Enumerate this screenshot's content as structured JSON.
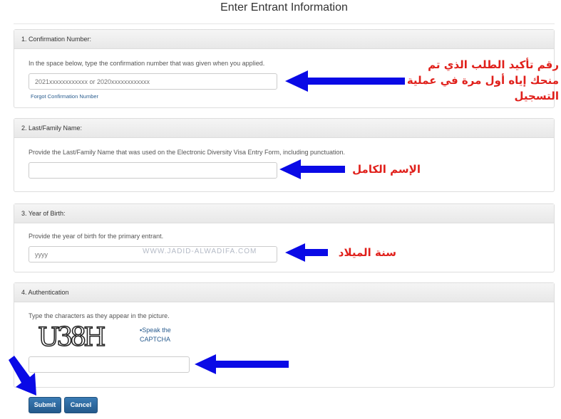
{
  "page_title": "Enter Entrant Information",
  "watermark": "WWW.JADID-ALWADIFA.COM",
  "sections": [
    {
      "header": "1. Confirmation Number:",
      "description": "In the space below, type the confirmation number that was given when you applied.",
      "placeholder": "2021xxxxxxxxxxxx or 2020xxxxxxxxxxxx",
      "link": "Forgot Confirmation Number"
    },
    {
      "header": "2. Last/Family Name:",
      "description": "Provide the Last/Family Name that was used on the Electronic Diversity Visa Entry Form, including punctuation.",
      "placeholder": ""
    },
    {
      "header": "3. Year of Birth:",
      "description": "Provide the year of birth for the primary entrant.",
      "placeholder": "yyyy"
    },
    {
      "header": "4. Authentication",
      "description": "Type the characters as they appear in the picture.",
      "captcha_text": "U38H",
      "speak_alt": "Speak the CAPTCHA",
      "placeholder": ""
    }
  ],
  "buttons": {
    "submit": "Submit",
    "cancel": "Cancel"
  },
  "annotations": {
    "confirmation": "رقم تأكيد الطلب الذي تم منحك إياه أول مرة في عملية التسجيل",
    "name": "الإسم الكامل",
    "birth_year": "سنة الميلاد"
  },
  "colors": {
    "arrow": "#0a0ae6",
    "annotation": "#e0201b",
    "button": "#2d6aa0"
  }
}
